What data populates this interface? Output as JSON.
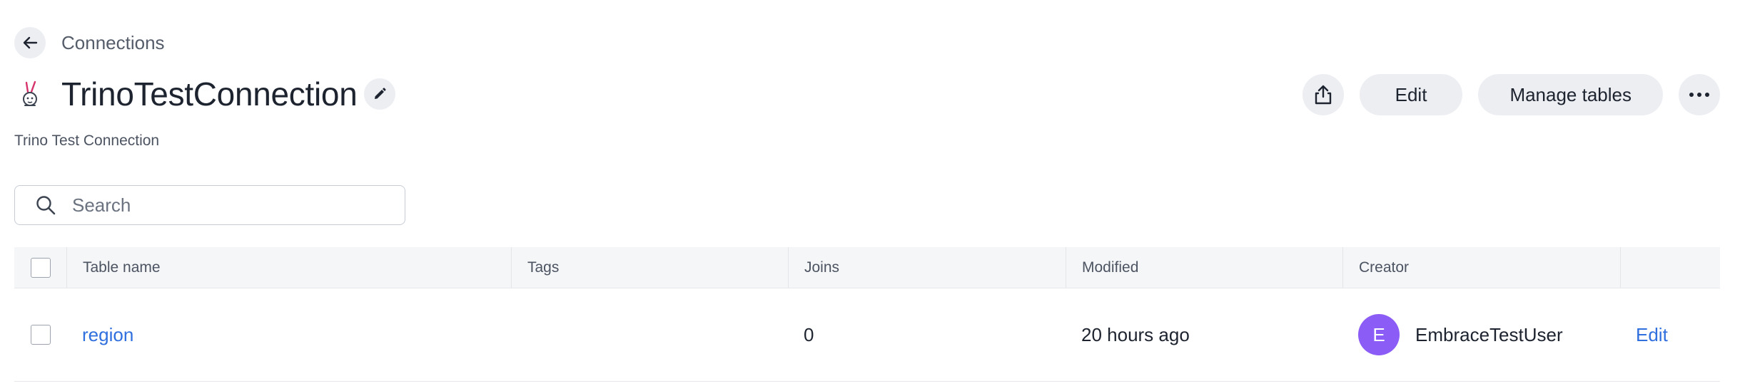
{
  "breadcrumb": {
    "back_icon": "arrow-left-icon",
    "parent_label": "Connections"
  },
  "header": {
    "title": "TrinoTestConnection",
    "description": "Trino Test Connection",
    "logo_icon": "trino-bunny-icon",
    "title_edit_icon": "pencil-icon"
  },
  "actions": {
    "share_icon": "share-icon",
    "edit_label": "Edit",
    "manage_tables_label": "Manage tables",
    "more_icon": "more-horizontal-icon"
  },
  "search": {
    "placeholder": "Search",
    "value": ""
  },
  "table": {
    "columns": [
      "Table name",
      "Tags",
      "Joins",
      "Modified",
      "Creator"
    ],
    "rows": [
      {
        "name": "region",
        "tags": "",
        "joins": "0",
        "modified": "20 hours ago",
        "creator_initial": "E",
        "creator": "EmbraceTestUser",
        "action": "Edit"
      }
    ]
  },
  "colors": {
    "accent_link": "#2f6fde",
    "avatar": "#8b5cf6",
    "button_bg": "#eceef2",
    "header_bg": "#f5f6f8"
  }
}
